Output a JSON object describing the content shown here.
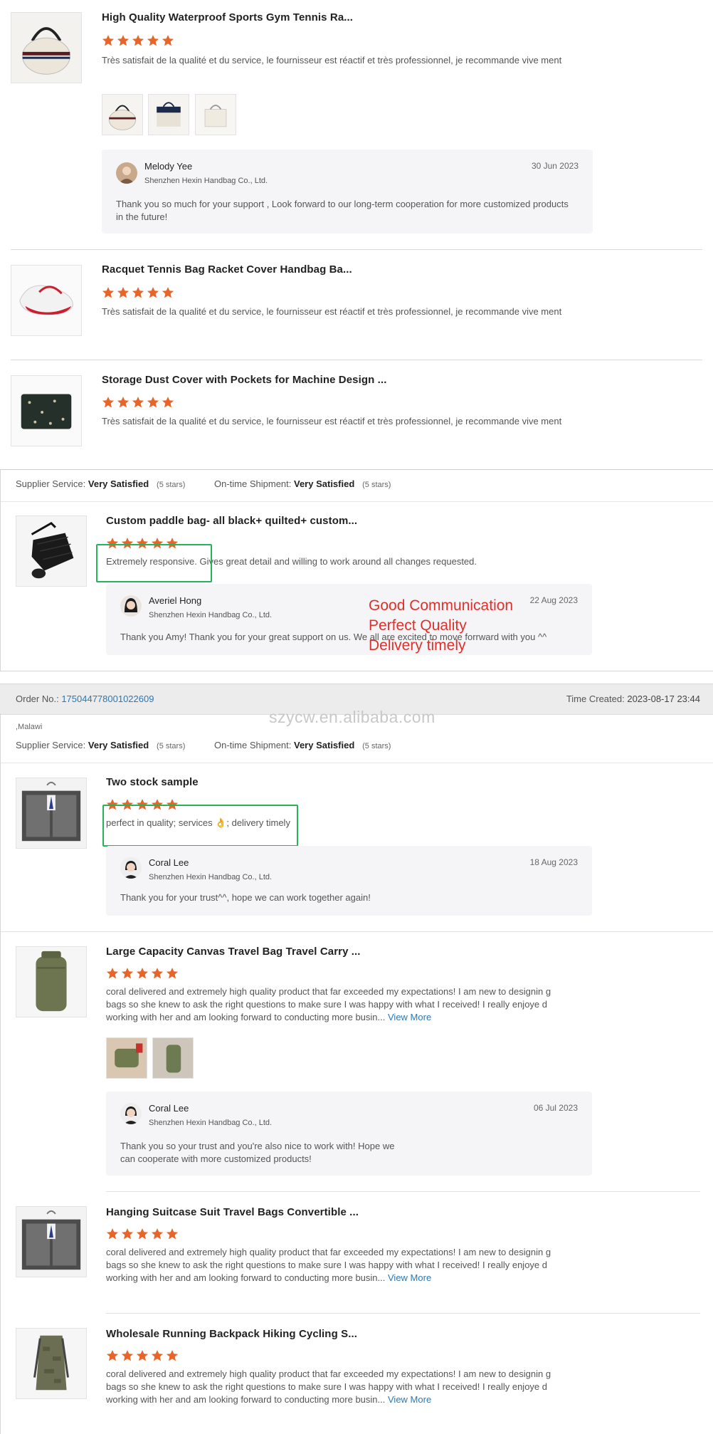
{
  "colors": {
    "star": "#e8652a",
    "link": "#2a78b5",
    "annotation": "#e0302b",
    "highlight_box": "#27b35a",
    "gray_band": "#ececec"
  },
  "reviews_top": [
    {
      "title": "High Quality Waterproof Sports Gym Tennis Ra...",
      "rating": 5,
      "text": "Très satisfait de la qualité et du service, le fournisseur est réactif et très professionnel, je recommande vive ment"
    },
    {
      "title": "Racquet Tennis Bag Racket Cover Handbag Ba...",
      "rating": 5,
      "text": "Très satisfait de la qualité et du service, le fournisseur est réactif et très professionnel, je recommande vive ment"
    },
    {
      "title": "Storage Dust Cover with Pockets for Machine Design ...",
      "rating": 5,
      "text": "Très satisfait de la qualité et du service, le fournisseur est réactif et très professionnel, je recommande vive ment"
    }
  ],
  "reply1": {
    "name": "Melody Yee",
    "company": "Shenzhen Hexin Handbag Co., Ltd.",
    "date": "30 Jun 2023",
    "text": "Thank you so much for your support , Look forward to our long-term cooperation for more customized products in the future!"
  },
  "section1": {
    "service_label": "Supplier Service:",
    "service_value": "Very Satisfied",
    "service_stars": "(5 stars)",
    "shipment_label": "On-time Shipment:",
    "shipment_value": "Very Satisfied",
    "shipment_stars": "(5 stars)",
    "review": {
      "title": "Custom paddle bag- all black+ quilted+ custom...",
      "rating": 5,
      "text": "Extremely responsive. Gives great detail and willing to work around all changes requested."
    },
    "reply": {
      "name": "Averiel Hong",
      "company": "Shenzhen Hexin Handbag Co., Ltd.",
      "date": "22 Aug 2023",
      "text": "Thank you Amy!  Thank you for your great support on us.  We all are excited to move forrward with you ^^"
    },
    "annotations": [
      "Good Communication",
      "Perfect Quality",
      "Delivery timely"
    ]
  },
  "order": {
    "label": "Order No.:",
    "number": "175044778001022609",
    "time_label": "Time Created:",
    "time_value": "2023-08-17 23:44",
    "country": ",Malawi"
  },
  "watermark": "szycw.en.alibaba.com",
  "section2": {
    "service_label": "Supplier Service:",
    "service_value": "Very Satisfied",
    "service_stars": "(5 stars)",
    "shipment_label": "On-time Shipment:",
    "shipment_value": "Very Satisfied",
    "shipment_stars": "(5 stars)",
    "reviews": [
      {
        "title": "Two stock sample",
        "rating": 5,
        "text": "perfect in quality; services 👌; delivery timely"
      },
      {
        "title": "Large Capacity Canvas Travel Bag Travel Carry ...",
        "rating": 5,
        "text": "coral delivered and extremely high quality product that far exceeded my expectations! I am new to designin g bags so she knew to ask the right questions to make sure I was happy with what I received! I really enjoye d working with her and am looking forward to conducting more busin...",
        "view_more": "View More"
      },
      {
        "title": "Hanging Suitcase Suit Travel Bags Convertible ...",
        "rating": 5,
        "text": "coral delivered and extremely high quality product that far exceeded my expectations! I am new to designin g bags so she knew to ask the right questions to make sure I was happy with what I received! I really enjoye d working with her and am looking forward to conducting more busin...",
        "view_more": "View More"
      },
      {
        "title": "Wholesale Running Backpack Hiking Cycling S...",
        "rating": 5,
        "text": "coral delivered and extremely high quality product that far exceeded my expectations! I am new to designin g bags so she knew to ask the right questions to make sure I was happy with what I received! I really enjoye d working with her and am looking forward to conducting more busin...",
        "view_more": "View More"
      }
    ],
    "reply_a": {
      "name": "Coral Lee",
      "company": "Shenzhen Hexin Handbag Co., Ltd.",
      "date": "18 Aug 2023",
      "text": "Thank you for your trust^^, hope we can work together again!"
    },
    "reply_b": {
      "name": "Coral Lee",
      "company": "Shenzhen Hexin Handbag Co., Ltd.",
      "date": "06 Jul 2023",
      "text": "Thank you so your trust and you're also nice to work with! Hope we can cooperate with more customized products!"
    }
  }
}
